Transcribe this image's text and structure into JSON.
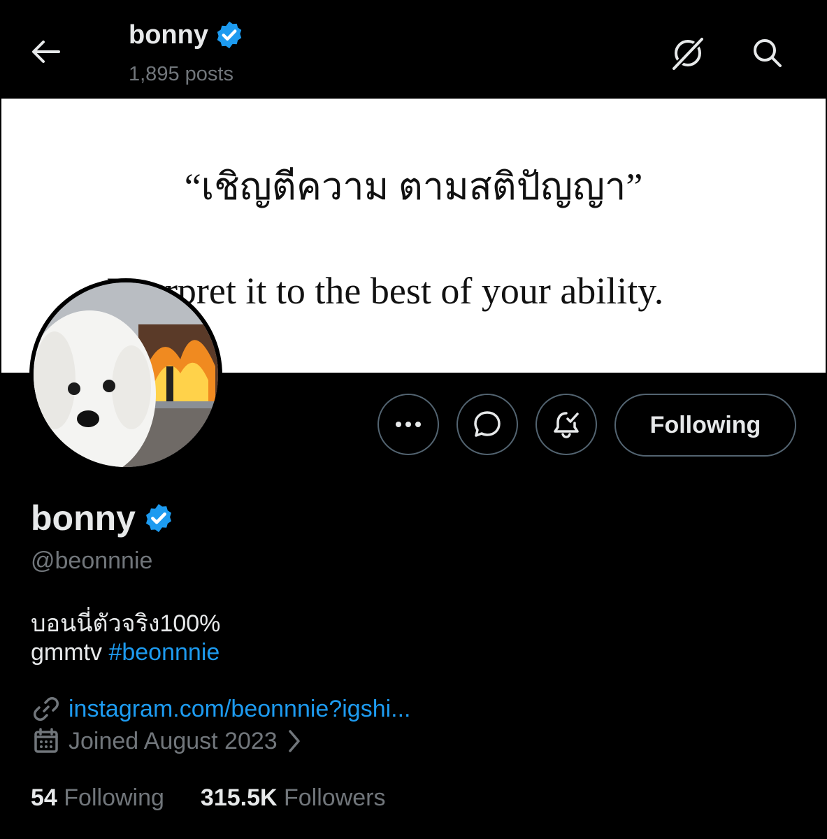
{
  "header": {
    "name": "bonny",
    "posts": "1,895 posts"
  },
  "banner": {
    "thai_quote": "“เชิญตีความ ตามสติปัญญา”",
    "english": "Interpret it to the best of your ability."
  },
  "actions": {
    "following_label": "Following"
  },
  "profile": {
    "display_name": "bonny",
    "handle": "@beonnnie",
    "bio_line1": "บอนนี่ตัวจริง100%",
    "bio_line2_prefix": "gmmtv ",
    "bio_hashtag": "#beonnnie",
    "link": "instagram.com/beonnnie?igshi...",
    "joined": "Joined August 2023"
  },
  "stats": {
    "following_count": "54",
    "following_label": "Following",
    "followers_count": "315.5K",
    "followers_label": "Followers"
  },
  "colors": {
    "accent": "#1d9bf0",
    "muted": "#71767b",
    "border": "#536471",
    "background": "#000000"
  }
}
